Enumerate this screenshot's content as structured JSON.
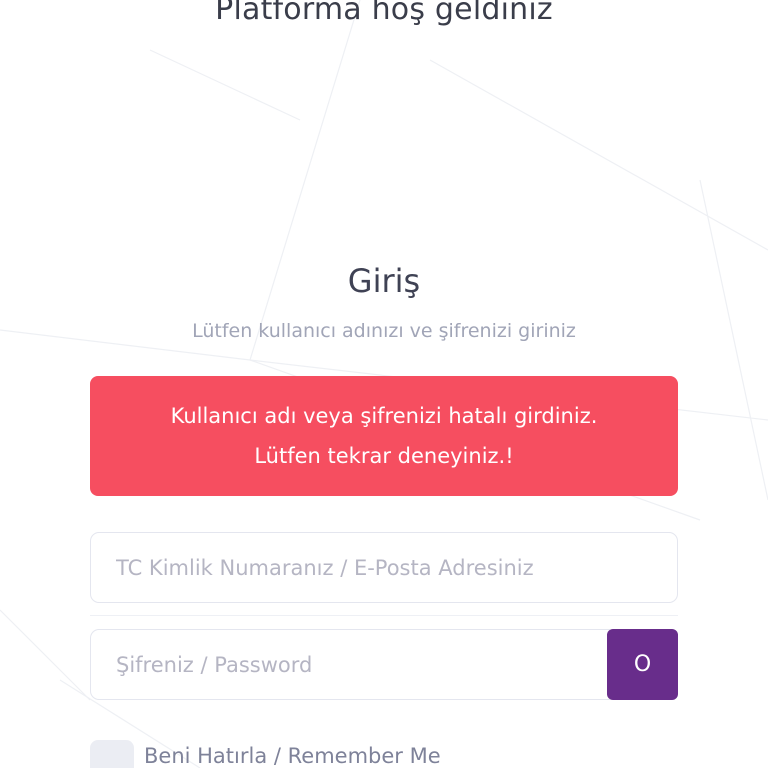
{
  "header": {
    "welcome": "Platforma hoş geldiniz"
  },
  "login": {
    "title": "Giriş",
    "subtitle": "Lütfen kullanıcı adınızı ve şifrenizi giriniz",
    "alert": {
      "line1": "Kullanıcı adı veya şifrenizi hatalı girdiniz.",
      "line2": "Lütfen tekrar deneyiniz.!"
    },
    "username": {
      "value": "",
      "placeholder": "TC Kimlik Numaranız / E-Posta Adresiniz"
    },
    "password": {
      "value": "",
      "placeholder": "Şifreniz / Password"
    },
    "toggle_label": "O",
    "remember_label": "Beni Hatırla / Remember Me"
  },
  "colors": {
    "alert": "#f64e60",
    "accent": "#682d8b",
    "title": "#3f4254",
    "muted": "#a1a5b7"
  },
  "icons": {
    "password_toggle": "eye-toggle-icon"
  }
}
